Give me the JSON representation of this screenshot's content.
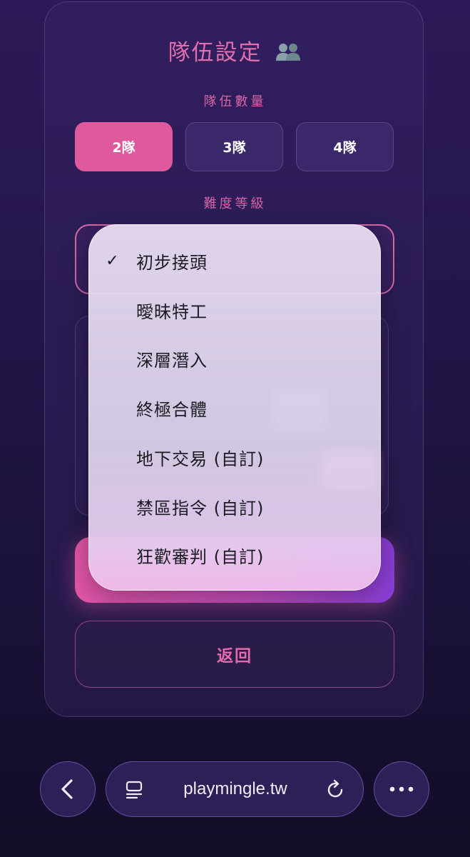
{
  "title": "隊伍設定",
  "title_icon": "people-icon",
  "team_count_label": "隊伍數量",
  "team_options": [
    "2隊",
    "3隊",
    "4隊"
  ],
  "team_selected": "2隊",
  "difficulty_label": "難度等級",
  "difficulty_options": [
    {
      "label": "初步接頭",
      "checked": true
    },
    {
      "label": "曖昧特工",
      "checked": false
    },
    {
      "label": "深層潛入",
      "checked": false
    },
    {
      "label": "終極合體",
      "checked": false
    },
    {
      "label": "地下交易 (自訂)",
      "checked": false
    },
    {
      "label": "禁區指令 (自訂)",
      "checked": false
    },
    {
      "label": "狂歡審判 (自訂)",
      "checked": false
    }
  ],
  "check_mark": "✓",
  "back_label": "返回",
  "browser": {
    "url": "playmingle.tw",
    "back_icon": "chevron-left-icon",
    "reader_icon": "reader-icon",
    "reload_icon": "reload-icon",
    "more_icon": "more-icon"
  },
  "colors": {
    "accent": "#df5a9d",
    "accent_text": "#e06fae",
    "background": "#24164a"
  }
}
